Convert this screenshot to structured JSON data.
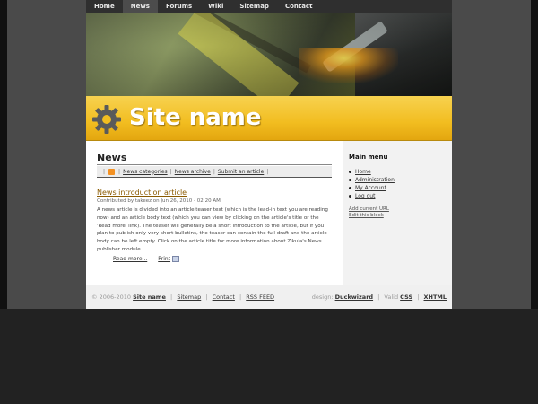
{
  "nav": {
    "items": [
      {
        "label": "Home"
      },
      {
        "label": "News"
      },
      {
        "label": "Forums"
      },
      {
        "label": "Wiki"
      },
      {
        "label": "Sitemap"
      },
      {
        "label": "Contact"
      }
    ],
    "active": "News"
  },
  "header": {
    "site_name": "Site name",
    "logo_icon": "gear-icon"
  },
  "news": {
    "title": "News",
    "subnav": {
      "rss_icon": "rss-icon",
      "links": [
        "News categories",
        "News archive",
        "Submit an article"
      ]
    },
    "article": {
      "title": "News introduction article",
      "meta": "Contributed by takeez on Jun 26, 2010 - 02:20 AM",
      "body": "A news article is divided into an article teaser text (which is the lead-in text you are reading now) and an article body text (which you can view by clicking on the article's title or the 'Read more' link). The teaser will generally be a short introduction to the article, but if you plan to publish only very short bulletins, the teaser can contain the full draft and the article body can be left empty. Click on the article title for more information about Zikula's News publisher module.",
      "read_more": "Read more...",
      "print": "Print",
      "print_icon": "print-icon"
    }
  },
  "sidebar": {
    "main_menu_title": "Main menu",
    "menu_items": [
      "Home",
      "Administration",
      "My Account",
      "Log out"
    ],
    "admin_links": [
      "Add current URL",
      "Edit this block"
    ]
  },
  "footer": {
    "copyright": "© 2006-2010",
    "site_name": "Site name",
    "links": [
      "Sitemap",
      "Contact",
      "RSS FEED"
    ],
    "design_label": "design:",
    "designer": "Duckwizard",
    "valid_label": "Valid",
    "valid_links": [
      "CSS",
      "XHTML"
    ]
  },
  "colors": {
    "header_yellow": "#f2bd20",
    "nav_bg": "#2f2f2f",
    "page_bg": "#222222"
  }
}
